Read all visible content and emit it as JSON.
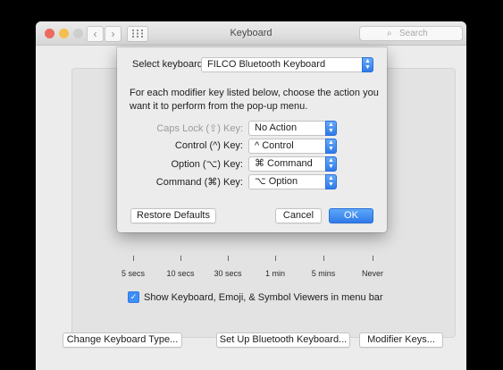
{
  "window": {
    "title": "Keyboard",
    "search_placeholder": "Search",
    "nav_back": "‹",
    "nav_forward": "›",
    "grid_icon": "grid-icon",
    "search_icon": "search-icon"
  },
  "colors": {
    "traffic_close": "#ed6a5e",
    "traffic_minimize": "#f5bf4f",
    "traffic_zoom": "#cfcfcf",
    "accent": "#3d8ef7"
  },
  "sheet": {
    "select_label": "Select keyboard:",
    "keyboard_value": "FILCO Bluetooth Keyboard",
    "description": "For each modifier key listed below, choose the action you want it to perform from the pop-up menu.",
    "rows": [
      {
        "label": "Caps Lock (⇪) Key:",
        "value": "No Action",
        "disabled": true
      },
      {
        "label": "Control (^) Key:",
        "value": "^ Control",
        "disabled": false
      },
      {
        "label": "Option (⌥) Key:",
        "value": "⌘ Command",
        "disabled": false
      },
      {
        "label": "Command (⌘) Key:",
        "value": "⌥ Option",
        "disabled": false
      }
    ],
    "restore_label": "Restore Defaults",
    "cancel_label": "Cancel",
    "ok_label": "OK"
  },
  "main": {
    "ticks": [
      "5 secs",
      "10 secs",
      "30 secs",
      "1 min",
      "5 mins",
      "Never"
    ],
    "checkbox_checked": true,
    "checkbox_label": "Show Keyboard, Emoji, & Symbol Viewers in menu bar",
    "change_type_label": "Change Keyboard Type...",
    "bluetooth_label": "Set Up Bluetooth Keyboard...",
    "modifier_label": "Modifier Keys..."
  }
}
